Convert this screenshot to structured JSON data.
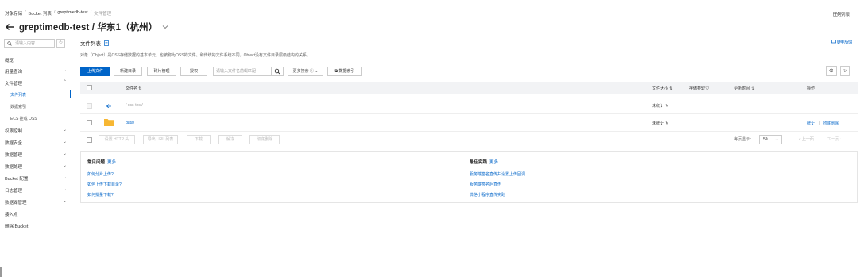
{
  "breadcrumb": [
    "对象存储",
    "Bucket 列表",
    "greptimedb-test",
    "文件管理"
  ],
  "header": {
    "title": "greptimedb-test / 华东1（杭州）",
    "task_list": "任务列表"
  },
  "sidebar": {
    "search_placeholder": "请输入内容",
    "items": [
      {
        "label": "概览"
      },
      {
        "label": "用量查询"
      },
      {
        "label": "文件管理"
      },
      {
        "label": "权限控制"
      },
      {
        "label": "数据安全"
      },
      {
        "label": "数据管理"
      },
      {
        "label": "数据处理"
      },
      {
        "label": "Bucket 配置"
      },
      {
        "label": "日志管理"
      },
      {
        "label": "数据湖管理"
      },
      {
        "label": "接入点"
      },
      {
        "label": "删除 Bucket"
      }
    ],
    "sub_items": [
      "文件列表",
      "数据索引",
      "ECS 挂载 OSS"
    ]
  },
  "main": {
    "section_title": "文件列表",
    "feedback": "使用反馈",
    "description": "对象（Object）是OSS存储数据的基本单元，也被称为OSS的文件。和传统的文件系统不同，Object没有文件目录层级结构的关系。",
    "toolbar": {
      "upload": "上传文件",
      "new_dir": "新建目录",
      "fragments": "碎片管理",
      "authorize": "授权",
      "search_placeholder": "请输入文件名前缀匹配",
      "more_search": "更多搜索",
      "data_index": "数据索引"
    },
    "columns": {
      "name": "文件名",
      "size": "文件大小",
      "storage": "存储类型",
      "updated": "更新时间",
      "ops": "操作"
    },
    "rows": [
      {
        "name": "oss-test/",
        "size": "未统计"
      },
      {
        "name": "data/",
        "size": "未统计",
        "op_stat": "统计",
        "op_delete": "彻底删除"
      }
    ],
    "batch": [
      "设置 HTTP 头",
      "导出 URL 列表",
      "下载",
      "解冻",
      "彻底删除"
    ],
    "pager": {
      "per_page_label": "每页显示:",
      "per_page": "50",
      "prev": "上一页",
      "next": "下一页"
    },
    "help": {
      "faq_title": "常见问题",
      "best_title": "最佳实践",
      "more": "更多",
      "faq": [
        "如何分片上传?",
        "如何上传下载目录?",
        "如何批量下载?"
      ],
      "best": [
        "服务端签名直传并设置上传回调",
        "服务端签名后直传",
        "微信小程序直传实践"
      ]
    }
  }
}
